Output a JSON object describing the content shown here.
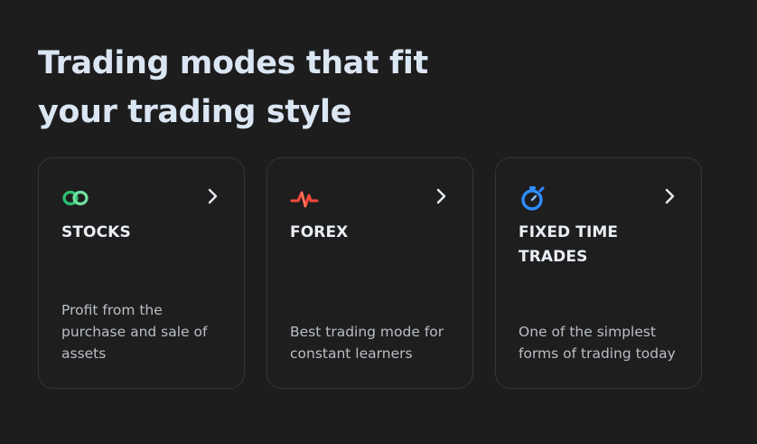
{
  "heading": {
    "line1": "Trading modes that fit",
    "line2": "your trading style"
  },
  "colors": {
    "background": "#1d1d1e",
    "heading": "#dbe6f3",
    "stocks_icon": "#2fbf71",
    "forex_icon": "#ff4a3d",
    "fixed_time_icon": "#2f8cff"
  },
  "cards": [
    {
      "icon": "infinity-icon",
      "title": "STOCKS",
      "description": "Profit from the purchase and sale of assets"
    },
    {
      "icon": "pulse-icon",
      "title": "FOREX",
      "description": "Best trading mode for constant learners"
    },
    {
      "icon": "stopwatch-icon",
      "title": "FIXED TIME TRADES",
      "description": "One of the simplest forms of trading today"
    }
  ]
}
